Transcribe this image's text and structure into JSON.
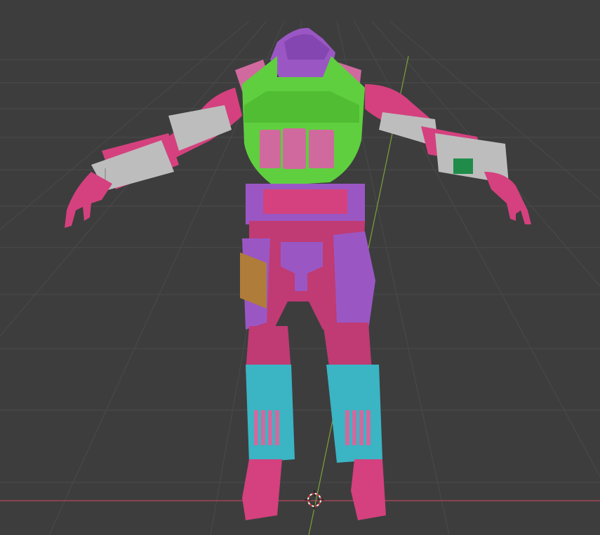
{
  "viewport": {
    "mode": "solid-shading-random-color",
    "background_color": "#3d3d3d",
    "grid_color": "#4a4a4a",
    "x_axis_color": "#b5485a",
    "y_axis_color": "#7fa03a"
  },
  "model": {
    "colors": {
      "pink": "#d4417e",
      "magenta": "#c03a74",
      "purple": "#9a57c4",
      "purple_dark": "#8446b0",
      "green": "#5fcf3f",
      "green_dark": "#48b02c",
      "light_pink": "#d06a9e",
      "gray": "#bdbdbd",
      "gray_dark": "#9d9d9d",
      "teal": "#3bb4c4",
      "tan": "#b07c3a",
      "badge_green": "#1f8c4a"
    }
  },
  "cursor_3d": {
    "icon": "3d-cursor-icon"
  }
}
